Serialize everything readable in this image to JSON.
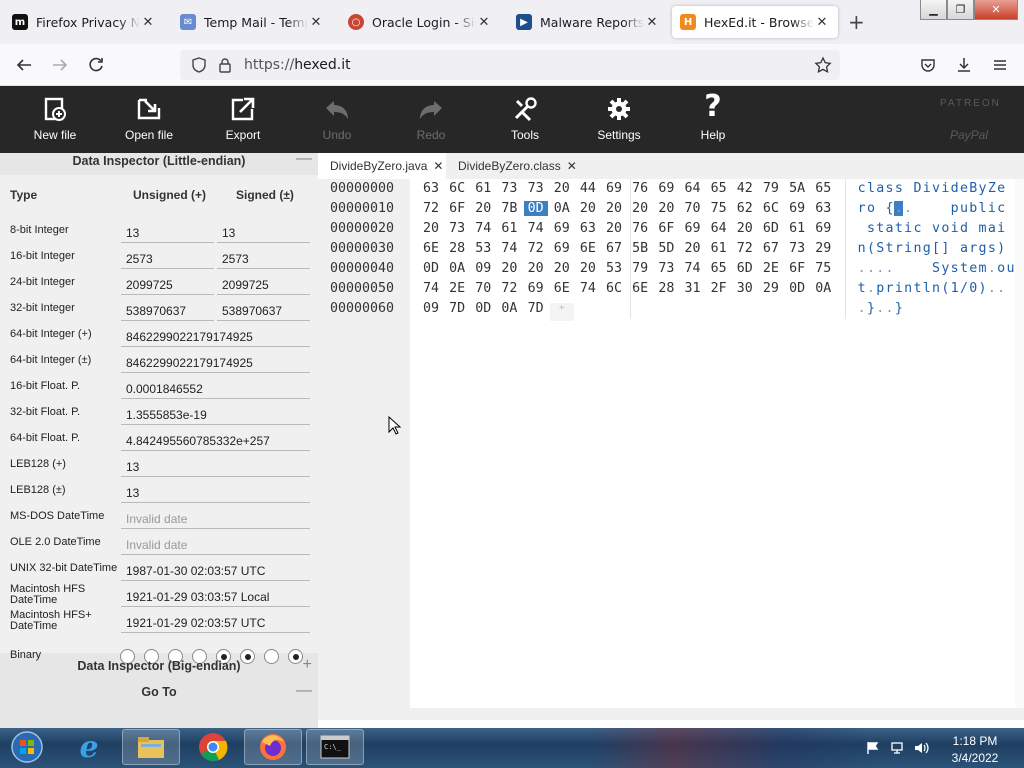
{
  "browser": {
    "tabs": [
      {
        "title": "Firefox Privacy Notice — Mozilla",
        "icon": "mozilla-m-icon",
        "active": false
      },
      {
        "title": "Temp Mail - Temporary Email",
        "icon": "tempmail-icon",
        "active": false
      },
      {
        "title": "Oracle Login - Single Sign On",
        "icon": "oracle-icon",
        "active": false
      },
      {
        "title": "Malware Reports - Online",
        "icon": "anyrun-icon",
        "active": false
      },
      {
        "title": "HexEd.it - Browser-based",
        "icon": "hexed-shield-icon",
        "active": true
      }
    ],
    "url": "https://hexed.it",
    "url_scheme": "https://",
    "url_host": "hexed.it"
  },
  "toolbar": {
    "items": [
      {
        "label": "New file",
        "icon": "new-file-icon",
        "enabled": true
      },
      {
        "label": "Open file",
        "icon": "open-file-icon",
        "enabled": true
      },
      {
        "label": "Export",
        "icon": "export-icon",
        "enabled": true
      },
      {
        "label": "Undo",
        "icon": "undo-icon",
        "enabled": false
      },
      {
        "label": "Redo",
        "icon": "redo-icon",
        "enabled": false
      },
      {
        "label": "Tools",
        "icon": "tools-icon",
        "enabled": true
      },
      {
        "label": "Settings",
        "icon": "gear-icon",
        "enabled": true
      },
      {
        "label": "Help",
        "icon": "question-icon",
        "enabled": true
      }
    ],
    "patreon": "PATREON",
    "paypal": "PayPal"
  },
  "inspector": {
    "title": "Data Inspector (Little-endian)",
    "collapse_symbol": "—",
    "col_type": "Type",
    "col_unsigned": "Unsigned (+)",
    "col_signed": "Signed (±)",
    "rows": [
      {
        "name": "8-bit Integer",
        "unsigned": "13",
        "signed": "13"
      },
      {
        "name": "16-bit Integer",
        "unsigned": "2573",
        "signed": "2573"
      },
      {
        "name": "24-bit Integer",
        "unsigned": "2099725",
        "signed": "2099725"
      },
      {
        "name": "32-bit Integer",
        "unsigned": "538970637",
        "signed": "538970637"
      },
      {
        "name": "64-bit Integer (+)",
        "value": "8462299022179174925"
      },
      {
        "name": "64-bit Integer (±)",
        "value": "8462299022179174925"
      },
      {
        "name": "16-bit Float. P.",
        "value": "0.0001846552"
      },
      {
        "name": "32-bit Float. P.",
        "value": "1.3555853e-19"
      },
      {
        "name": "64-bit Float. P.",
        "value": "4.842495560785332e+257"
      },
      {
        "name": "LEB128 (+)",
        "value": "13"
      },
      {
        "name": "LEB128 (±)",
        "value": "13"
      },
      {
        "name": "MS-DOS DateTime",
        "placeholder": "Invalid date"
      },
      {
        "name": "OLE 2.0 DateTime",
        "placeholder": "Invalid date"
      },
      {
        "name": "UNIX 32-bit DateTime",
        "value": "1987-01-30 02:03:57 UTC"
      },
      {
        "name": "Macintosh HFS DateTime",
        "value": "1921-01-29 03:03:57 Local"
      },
      {
        "name": "Macintosh HFS+ DateTime",
        "value": "1921-01-29 02:03:57 UTC"
      }
    ],
    "binary_label": "Binary",
    "binary_bits": [
      0,
      0,
      0,
      0,
      1,
      1,
      0,
      1
    ],
    "big_endian_title": "Data Inspector (Big-endian)",
    "expand_symbol": "+",
    "goto_title": "Go To",
    "goto_symbol": "—"
  },
  "editor": {
    "file_tabs": [
      {
        "name": "DivideByZero.java",
        "active": true
      },
      {
        "name": "DivideByZero.class",
        "active": false
      }
    ],
    "close_symbol": "✕",
    "add_symbol": "+",
    "rows": [
      {
        "offset": "00000000",
        "bytes": [
          "63",
          "6C",
          "61",
          "73",
          "73",
          "20",
          "44",
          "69",
          "76",
          "69",
          "64",
          "65",
          "42",
          "79",
          "5A",
          "65"
        ],
        "ascii": "class DivideByZe"
      },
      {
        "offset": "00000010",
        "bytes": [
          "72",
          "6F",
          "20",
          "7B",
          "0D",
          "0A",
          "20",
          "20",
          "20",
          "20",
          "70",
          "75",
          "62",
          "6C",
          "69",
          "63"
        ],
        "ascii": "ro {..    public"
      },
      {
        "offset": "00000020",
        "bytes": [
          "20",
          "73",
          "74",
          "61",
          "74",
          "69",
          "63",
          "20",
          "76",
          "6F",
          "69",
          "64",
          "20",
          "6D",
          "61",
          "69"
        ],
        "ascii": " static void mai"
      },
      {
        "offset": "00000030",
        "bytes": [
          "6E",
          "28",
          "53",
          "74",
          "72",
          "69",
          "6E",
          "67",
          "5B",
          "5D",
          "20",
          "61",
          "72",
          "67",
          "73",
          "29"
        ],
        "ascii": "n(String[] args)"
      },
      {
        "offset": "00000040",
        "bytes": [
          "0D",
          "0A",
          "09",
          "20",
          "20",
          "20",
          "20",
          "53",
          "79",
          "73",
          "74",
          "65",
          "6D",
          "2E",
          "6F",
          "75"
        ],
        "ascii": "....    System.ou"
      },
      {
        "offset": "00000050",
        "bytes": [
          "74",
          "2E",
          "70",
          "72",
          "69",
          "6E",
          "74",
          "6C",
          "6E",
          "28",
          "31",
          "2F",
          "30",
          "29",
          "0D",
          "0A"
        ],
        "ascii": "t.println(1/0).."
      },
      {
        "offset": "00000060",
        "bytes": [
          "09",
          "7D",
          "0D",
          "0A",
          "7D"
        ],
        "ascii": ".}..}"
      }
    ],
    "selected_byte": {
      "row": 1,
      "col": 4
    }
  },
  "taskbar": {
    "apps": [
      "start-orb",
      "internet-explorer-icon",
      "file-explorer-icon",
      "chrome-icon",
      "firefox-icon",
      "cmd-icon"
    ],
    "time": "1:18 PM",
    "date": "3/4/2022"
  }
}
